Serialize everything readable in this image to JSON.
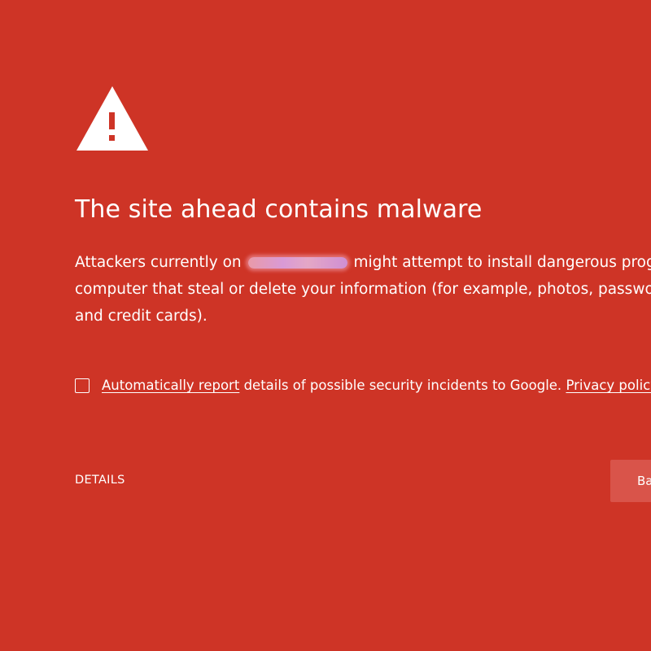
{
  "page": {
    "background_color": "#ce3426",
    "icon": "warning-triangle-icon"
  },
  "heading": "The site ahead contains malware",
  "body": {
    "line1_before": "Attackers currently on",
    "line1_after": "might attempt to install dangerous progr",
    "line2": "computer that steal or delete your information (for example, photos, passwor",
    "line3": "and credit cards)."
  },
  "report": {
    "checked": false,
    "link_text": "Automatically report",
    "text": "details of possible security incidents to Google.",
    "privacy_link": "Privacy policy"
  },
  "actions": {
    "details_label": "DETAILS",
    "back_label": "Back to safety"
  }
}
